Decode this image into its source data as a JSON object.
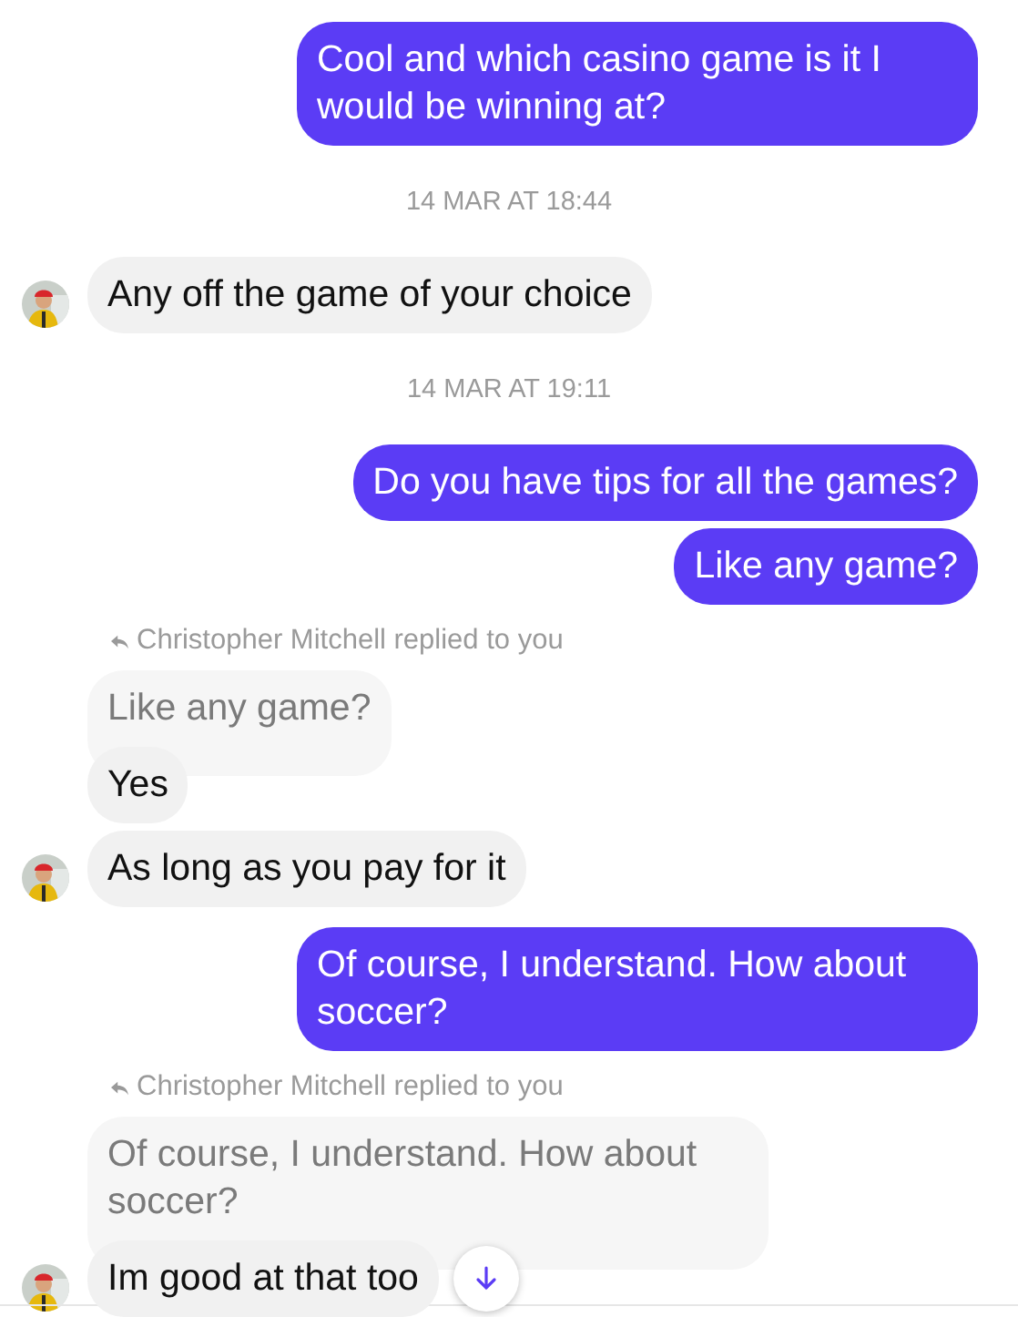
{
  "messages": [
    {
      "kind": "sent",
      "text": "Cool and which casino game is it I would be winning at?"
    },
    {
      "kind": "timestamp",
      "text": "14 MAR AT 18:44"
    },
    {
      "kind": "received",
      "text": "Any off the game of your choice",
      "avatar": true
    },
    {
      "kind": "timestamp",
      "text": "14 MAR AT 19:11"
    },
    {
      "kind": "sent",
      "text": "Do you have tips for all the games?"
    },
    {
      "kind": "sent",
      "text": "Like any game?"
    },
    {
      "kind": "reply_note",
      "text": "Christopher Mitchell replied to you"
    },
    {
      "kind": "quote",
      "text": "Like any game?"
    },
    {
      "kind": "received",
      "text": "Yes",
      "avatar": false
    },
    {
      "kind": "received",
      "text": "As long as you pay for it",
      "avatar": true
    },
    {
      "kind": "sent",
      "text": "Of course, I understand. How about soccer?"
    },
    {
      "kind": "reply_note",
      "text": "Christopher Mitchell replied to you"
    },
    {
      "kind": "quote",
      "text": "Of course, I understand. How about soccer?"
    },
    {
      "kind": "received",
      "text": "Im good at that too",
      "avatar": true,
      "scroll_down_button": true
    }
  ]
}
